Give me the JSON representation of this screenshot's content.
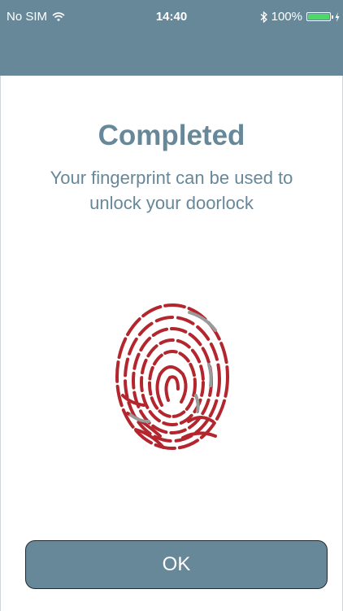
{
  "status_bar": {
    "carrier": "No SIM",
    "time": "14:40",
    "battery": "100%"
  },
  "content": {
    "title": "Completed",
    "subtitle_line1": "Your fingerprint can be used to",
    "subtitle_line2": "unlock your doorlock"
  },
  "actions": {
    "ok_label": "OK"
  },
  "colors": {
    "header": "#668899",
    "accent": "#668899",
    "fingerprint": "#b3262e",
    "fingerprint_pending": "#9a9a9a"
  }
}
